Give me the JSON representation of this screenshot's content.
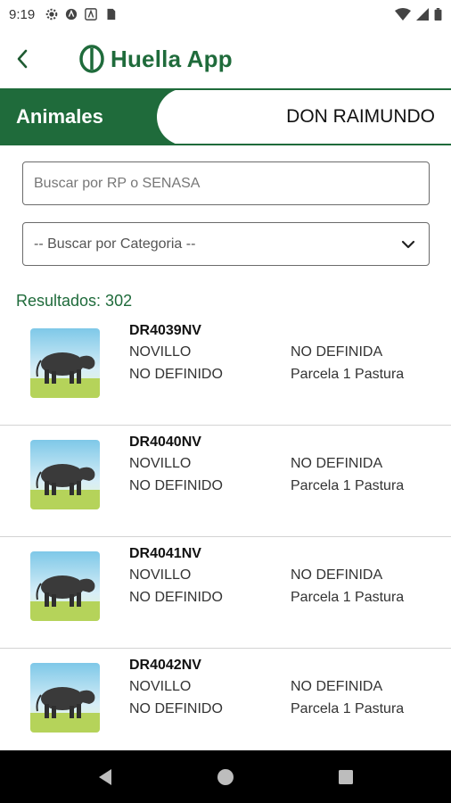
{
  "status_bar": {
    "time": "9:19"
  },
  "app": {
    "title": "Huella App"
  },
  "header": {
    "tab_label": "Animales",
    "farm_name": "DON RAIMUNDO"
  },
  "search": {
    "placeholder": "Buscar por RP o SENASA",
    "value": ""
  },
  "category_select": {
    "selected": "-- Buscar por Categoria --"
  },
  "results_text": "Resultados: 302",
  "animals": [
    {
      "rp": "DR4039NV",
      "category": "NOVILLO",
      "breed": "NO DEFINIDO",
      "status": "NO DEFINIDA",
      "location": "Parcela 1 Pastura"
    },
    {
      "rp": "DR4040NV",
      "category": "NOVILLO",
      "breed": "NO DEFINIDO",
      "status": "NO DEFINIDA",
      "location": "Parcela 1 Pastura"
    },
    {
      "rp": "DR4041NV",
      "category": "NOVILLO",
      "breed": "NO DEFINIDO",
      "status": "NO DEFINIDA",
      "location": "Parcela 1 Pastura"
    },
    {
      "rp": "DR4042NV",
      "category": "NOVILLO",
      "breed": "NO DEFINIDO",
      "status": "NO DEFINIDA",
      "location": "Parcela 1 Pastura"
    }
  ],
  "colors": {
    "brand_green": "#1f6b3b",
    "nav_bg": "#000000"
  }
}
